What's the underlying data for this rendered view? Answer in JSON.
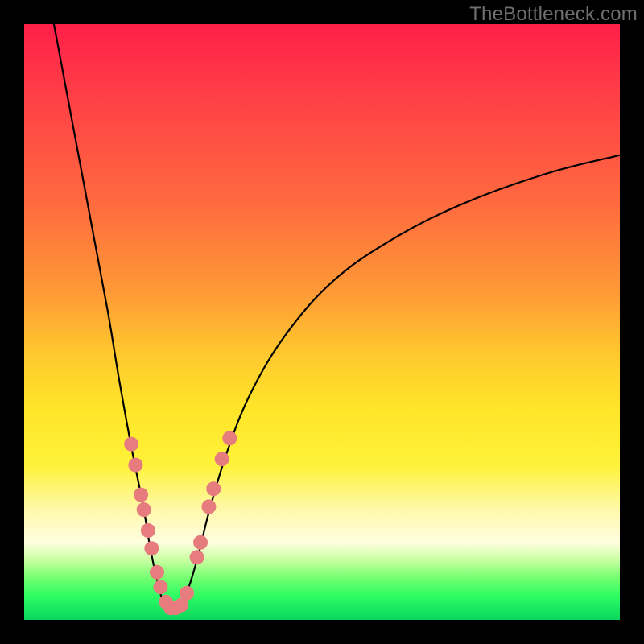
{
  "watermark": "TheBottleneck.com",
  "chart_data": {
    "type": "line",
    "title": "",
    "xlabel": "",
    "ylabel": "",
    "xlim": [
      0,
      100
    ],
    "ylim": [
      0,
      100
    ],
    "series": [
      {
        "name": "bottleneck-curve",
        "x": [
          5,
          8,
          11,
          14,
          16,
          18,
          20,
          21,
          22,
          23,
          24,
          25,
          27,
          29,
          31,
          34,
          38,
          44,
          52,
          62,
          74,
          88,
          100
        ],
        "y": [
          100,
          84,
          68,
          52,
          40,
          29,
          19,
          13,
          8,
          4,
          2,
          2,
          4,
          10,
          18,
          28,
          38,
          48,
          57,
          64,
          70,
          75,
          78
        ]
      }
    ],
    "dots": {
      "name": "sample-points",
      "color": "#e77c7e",
      "points": [
        {
          "x": 18.0,
          "y": 29.5
        },
        {
          "x": 18.7,
          "y": 26.0
        },
        {
          "x": 19.6,
          "y": 21.0
        },
        {
          "x": 20.1,
          "y": 18.5
        },
        {
          "x": 20.8,
          "y": 15.0
        },
        {
          "x": 21.4,
          "y": 12.0
        },
        {
          "x": 22.3,
          "y": 8.0
        },
        {
          "x": 22.9,
          "y": 5.5
        },
        {
          "x": 23.8,
          "y": 3.0
        },
        {
          "x": 24.6,
          "y": 2.0
        },
        {
          "x": 25.4,
          "y": 2.0
        },
        {
          "x": 26.4,
          "y": 2.5
        },
        {
          "x": 27.3,
          "y": 4.5
        },
        {
          "x": 29.0,
          "y": 10.5
        },
        {
          "x": 29.6,
          "y": 13.0
        },
        {
          "x": 31.0,
          "y": 19.0
        },
        {
          "x": 31.8,
          "y": 22.0
        },
        {
          "x": 33.2,
          "y": 27.0
        },
        {
          "x": 34.5,
          "y": 30.5
        }
      ]
    }
  }
}
